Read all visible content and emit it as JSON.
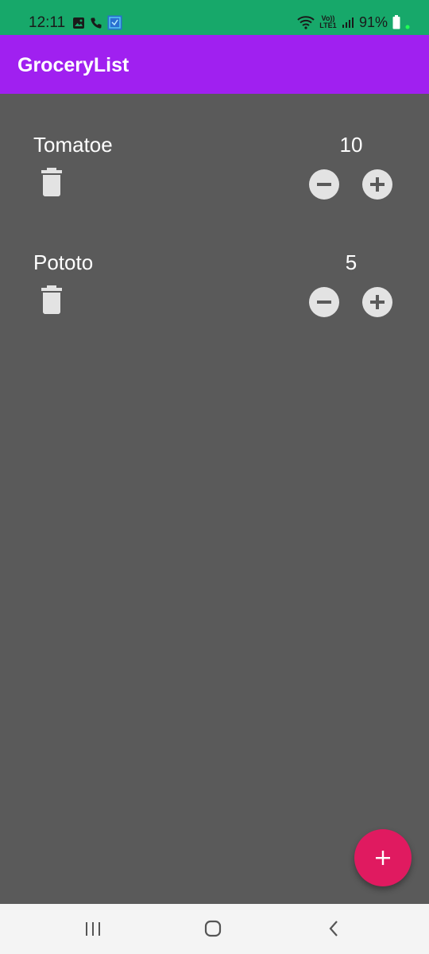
{
  "status_bar": {
    "time": "12:11",
    "battery_percent": "91%",
    "network_label": "Vo)) LTE1",
    "icons_left": [
      "gallery-icon",
      "phone-icon",
      "app-notification-icon"
    ],
    "icons_right": [
      "wifi-icon",
      "volte-lte-icon",
      "signal-icon",
      "battery-icon",
      "dot-indicator-icon"
    ],
    "color": "#17a86a"
  },
  "app_bar": {
    "title": "GroceryList",
    "color": "#a020f0"
  },
  "items": [
    {
      "name": "Tomatoe",
      "quantity": "10"
    },
    {
      "name": "Pototo",
      "quantity": "5"
    }
  ],
  "item_actions": {
    "delete_icon": "trash-icon",
    "decrement_icon": "minus-circle-icon",
    "increment_icon": "plus-circle-icon"
  },
  "fab": {
    "icon": "plus-icon",
    "color": "#e01a60"
  },
  "nav_bar": {
    "buttons": [
      "recents-icon",
      "home-icon",
      "back-icon"
    ]
  },
  "colors": {
    "background": "#5a5a5a",
    "text": "#ffffff",
    "control_fill": "#e3e3e3"
  }
}
